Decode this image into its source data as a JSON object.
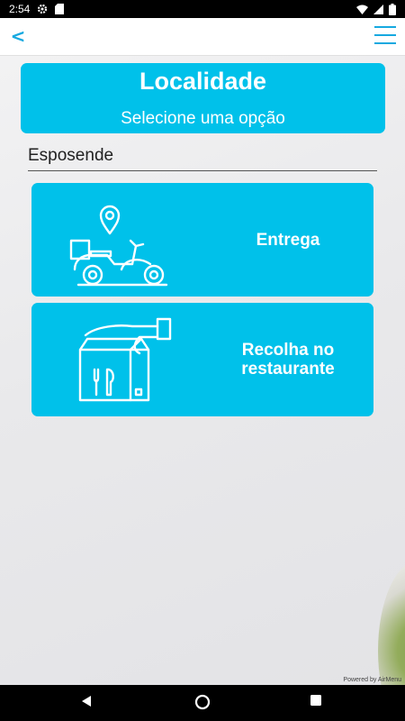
{
  "status_bar": {
    "time": "2:54",
    "icons": [
      "gear-icon",
      "sd-card-icon",
      "wifi-icon",
      "signal-icon",
      "battery-icon"
    ]
  },
  "header": {
    "back_label": "<",
    "menu_icon": "hamburger-menu-icon",
    "accent_color": "#16a9e0"
  },
  "main": {
    "title": "Localidade",
    "subtitle": "Selecione uma opção",
    "location_value": "Esposende",
    "card_color": "#00c1ea",
    "options": [
      {
        "label": "Entrega",
        "icon": "scooter-delivery-icon"
      },
      {
        "label": "Recolha no restaurante",
        "icon": "takeaway-bag-icon"
      }
    ]
  },
  "footer": {
    "powered_by": "Powered by AirMenu"
  },
  "nav_bar": {
    "buttons": [
      "back-triangle-icon",
      "home-circle-icon",
      "recents-square-icon"
    ]
  }
}
